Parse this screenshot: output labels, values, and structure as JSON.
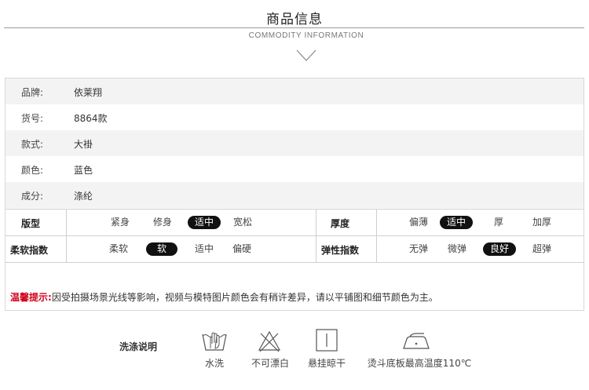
{
  "header": {
    "title": "商品信息",
    "subtitle": "COMMODITY INFORMATION",
    "chevron_icon": "chevron-down-icon"
  },
  "product": {
    "rows": [
      {
        "label": "品牌:",
        "value": "依莱翔"
      },
      {
        "label": "货号:",
        "value": "8864款"
      },
      {
        "label": "款式:",
        "value": "大褂"
      },
      {
        "label": "颜色:",
        "value": "蓝色"
      },
      {
        "label": "成分:",
        "value": "涤纶"
      }
    ]
  },
  "attributes": {
    "shape": {
      "label": "版型",
      "options": [
        "紧身",
        "修身",
        "适中",
        "宽松"
      ],
      "selected": "适中"
    },
    "thickness": {
      "label": "厚度",
      "options": [
        "偏薄",
        "适中",
        "厚",
        "加厚"
      ],
      "selected": "适中"
    },
    "softness": {
      "label": "柔软指数",
      "options": [
        "柔软",
        "软",
        "适中",
        "偏硬"
      ],
      "selected": "软"
    },
    "elasticity": {
      "label": "弹性指数",
      "options": [
        "无弹",
        "微弹",
        "良好",
        "超弹"
      ],
      "selected": "良好"
    },
    "selected_color": "#111111"
  },
  "notice": {
    "label": "温馨提示:",
    "text": "因受拍摄场景光线等影响，视频与模特图片颜色会有稍许差异，请以平铺图和细节颜色为主。",
    "label_color": "#d0021b"
  },
  "care": {
    "title": "洗涤说明",
    "items": [
      {
        "label": "水洗",
        "icon": "hand-wash-icon"
      },
      {
        "label": "不可漂白",
        "icon": "no-bleach-icon"
      },
      {
        "label": "悬挂晾干",
        "icon": "hang-dry-icon"
      },
      {
        "label": "烫斗底板最高温度110℃",
        "icon": "iron-icon"
      }
    ]
  }
}
